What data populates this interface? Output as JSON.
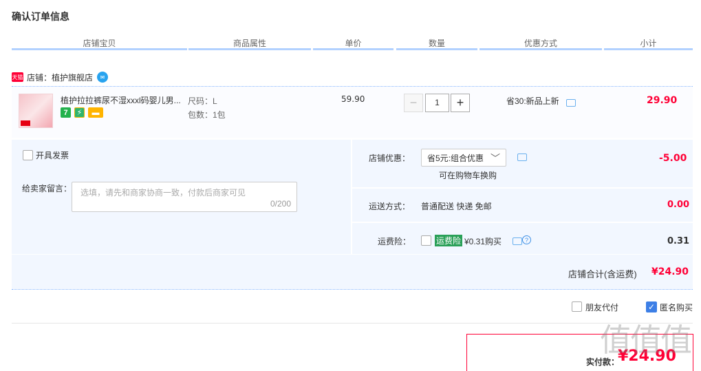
{
  "page_title": "确认订单信息",
  "columns": [
    "店铺宝贝",
    "商品属性",
    "单价",
    "数量",
    "优惠方式",
    "小计"
  ],
  "shop": {
    "badge": "天猫",
    "name": "店铺：植护旗舰店"
  },
  "item": {
    "name": "植护拉拉裤尿不湿xxxl码婴儿男...",
    "attr_size": "尺码：L",
    "attr_pack": "包数：1包",
    "unit_price": "59.90",
    "quantity": "1",
    "discount": "省30:新品上新",
    "subtotal": "29.90",
    "badge_7": "7"
  },
  "extras": {
    "invoice_label": "开具发票",
    "message_label": "给卖家留言：",
    "message_placeholder": "选填，请先和商家协商一致，付款后商家可见",
    "message_count": "0/200"
  },
  "shop_discount": {
    "label": "店铺优惠：",
    "selected": "省5元:组合优惠",
    "note": "可在购物车换购",
    "amount": "-5.00"
  },
  "shipping": {
    "label": "运送方式：",
    "value": "普通配送 快递 免邮",
    "amount": "0.00"
  },
  "insurance": {
    "label": "运费险：",
    "tag": "运费险",
    "text": "¥0.31购买",
    "amount": "0.31"
  },
  "shop_total": {
    "label": "店铺合计(含运费)",
    "amount": "¥24.90"
  },
  "options": {
    "friend_pay": "朋友代付",
    "anonymous": "匿名购买"
  },
  "payment": {
    "label": "实付款：",
    "amount": "¥24.90"
  },
  "colors": {
    "accent_red": "#ff0036",
    "header_line": "#b2d1ff",
    "panel_bg": "#f2f7ff"
  }
}
